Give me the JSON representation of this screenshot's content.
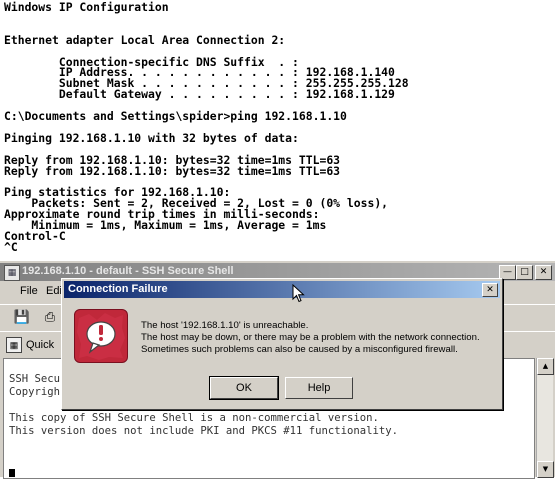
{
  "console": {
    "lines": [
      "Windows IP Configuration",
      "",
      "",
      "Ethernet adapter Local Area Connection 2:",
      "",
      "        Connection-specific DNS Suffix  . :",
      "        IP Address. . . . . . . . . . . . : 192.168.1.140",
      "        Subnet Mask . . . . . . . . . . . : 255.255.255.128",
      "        Default Gateway . . . . . . . . . : 192.168.1.129",
      "",
      "C:\\Documents and Settings\\spider>ping 192.168.1.10",
      "",
      "Pinging 192.168.1.10 with 32 bytes of data:",
      "",
      "Reply from 192.168.1.10: bytes=32 time=1ms TTL=63",
      "Reply from 192.168.1.10: bytes=32 time=1ms TTL=63",
      "",
      "Ping statistics for 192.168.1.10:",
      "    Packets: Sent = 2, Received = 2, Lost = 0 (0% loss),",
      "Approximate round trip times in milli-seconds:",
      "    Minimum = 1ms, Maximum = 1ms, Average = 1ms",
      "Control-C",
      "^C"
    ]
  },
  "ssh_window": {
    "title": "192.168.1.10 - default - SSH Secure Shell",
    "menu": {
      "file": "File",
      "edit": "Edi"
    },
    "quick_connect": "Quick",
    "terminal_lines": [
      "SSH Secu",
      "Copyrigh                                                          m/",
      "",
      "This copy of SSH Secure Shell is a non-commercial version.",
      "This version does not include PKI and PKCS #11 functionality."
    ]
  },
  "dialog": {
    "title": "Connection Failure",
    "message_lines": [
      "The host '192.168.1.10' is unreachable.",
      "The host may be down, or there may be a problem with the network connection.",
      "Sometimes such problems can also be caused by a misconfigured firewall."
    ],
    "ok_label": "OK",
    "help_label": "Help",
    "icon": "exclamation-icon"
  },
  "colors": {
    "dialog_titlebar": "#0a246a",
    "inactive_titlebar": "#808080",
    "window_face": "#d4d0c8",
    "error_icon": "#c0283a"
  }
}
